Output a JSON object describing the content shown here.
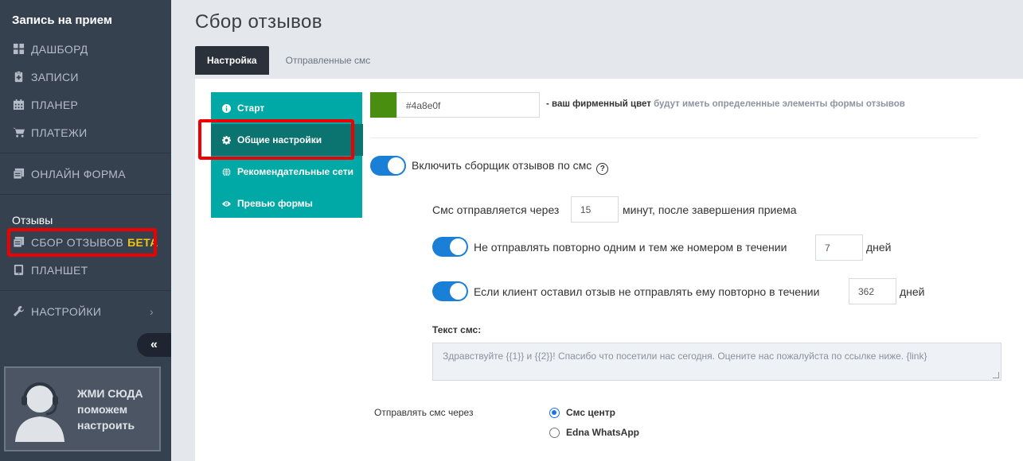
{
  "sidebar": {
    "header": "Запись на прием",
    "items": [
      {
        "label": "ДАШБОРД",
        "icon": "dashboard-grid-icon"
      },
      {
        "label": "ЗАПИСИ",
        "icon": "clipboard-icon"
      },
      {
        "label": "ПЛАНЕР",
        "icon": "calendar-icon"
      },
      {
        "label": "ПЛАТЕЖИ",
        "icon": "cart-icon"
      }
    ],
    "online_form": "ОНЛАЙН ФОРМА",
    "reviews_section": "Отзывы",
    "reviews_collect": "СБОР ОТЗЫВОВ",
    "beta": "БЕТА",
    "tablet": "ПЛАНШЕТ",
    "settings": "НАСТРОЙКИ",
    "collapse_glyph": "«",
    "help_line1": "ЖМИ СЮДА",
    "help_line2": "поможем",
    "help_line3": "настроить"
  },
  "page": {
    "title": "Сбор отзывов",
    "tabs": [
      "Настройка",
      "Отправленные смс"
    ]
  },
  "side_menu": {
    "items": [
      "Старт",
      "Общие настройки",
      "Рекомендательные сети",
      "Превью формы"
    ],
    "selected_index": 1
  },
  "form": {
    "color_value": "#4a8e0f",
    "color_hint_bold": "- ваш фирменный цвет",
    "color_hint_muted": "будут иметь определенные элементы формы отзывов",
    "enable_label": "Включить сборщик отзывов по смс",
    "help_glyph": "?",
    "sms_send_prefix": "Смс отправляется через",
    "sms_send_minutes": "15",
    "sms_send_suffix": "минут, после завершения приема",
    "no_repeat_label": "Не отправлять повторно одним и тем же номером в течении",
    "no_repeat_days": "7",
    "days": "дней",
    "reviewed_label": "Если клиент оставил отзыв не отправлять ему повторно в течении",
    "reviewed_days": "362",
    "sms_text_label": "Текст смс:",
    "sms_text_placeholder": "Здравствуйте {{1}} и {{2}}! Спасибо что посетили нас сегодня. Оцените нас пожалуйста по ссылке ниже. {link}",
    "send_via_label": "Отправлять смс через",
    "send_via_options": [
      "Смс центр",
      "Edna WhatsApp"
    ],
    "send_via_selected": 0
  },
  "colors": {
    "brand": "#4a8e0f",
    "accent": "#00a9a6",
    "accent_dark": "#0b7471",
    "toggle": "#1a7fd6",
    "highlight": "#ee0000"
  }
}
